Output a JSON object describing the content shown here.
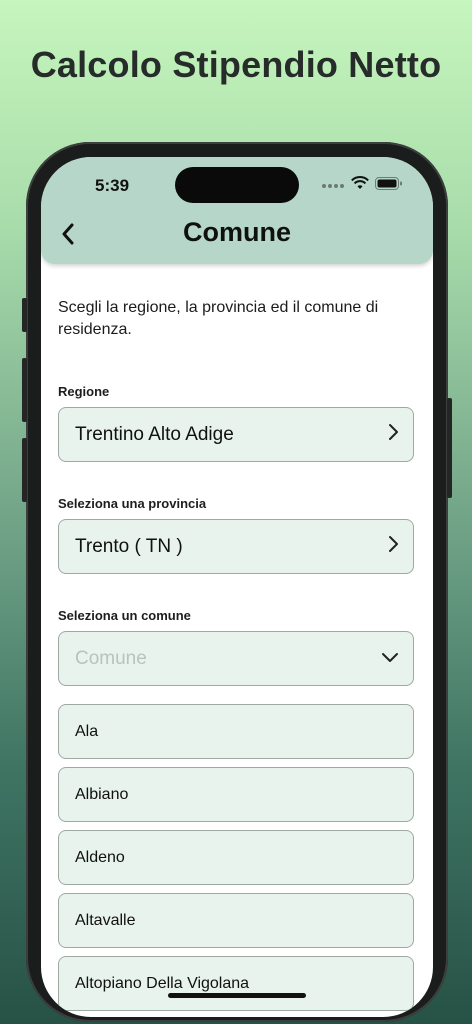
{
  "promo": {
    "title": "Calcolo Stipendio Netto"
  },
  "status_bar": {
    "time": "5:39"
  },
  "nav": {
    "title": "Comune"
  },
  "intro": "Scegli la regione, la provincia ed il comune di residenza.",
  "regione": {
    "label": "Regione",
    "value": "Trentino Alto Adige"
  },
  "provincia": {
    "label": "Seleziona una provincia",
    "value": "Trento ( TN )"
  },
  "comune": {
    "label": "Seleziona un comune",
    "placeholder": "Comune"
  },
  "options": [
    "Ala",
    "Albiano",
    "Aldeno",
    "Altavalle",
    "Altopiano Della Vigolana"
  ],
  "colors": {
    "header": "#b5d6c8",
    "field_bg": "#e7f3ec",
    "field_border": "#9fa9a4",
    "placeholder": "#b9c3be"
  }
}
